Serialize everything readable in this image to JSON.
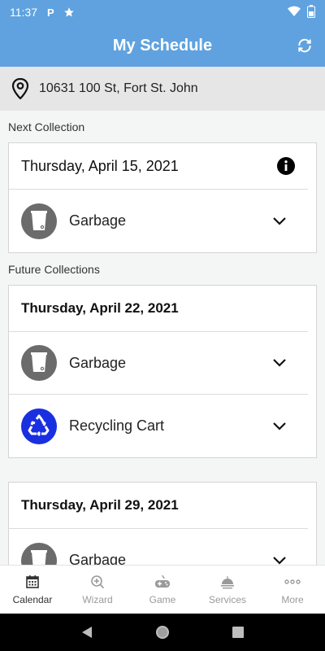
{
  "status_bar": {
    "time": "11:37"
  },
  "app_bar": {
    "title": "My Schedule"
  },
  "address": {
    "text": "10631 100 St, Fort St. John"
  },
  "next_collection": {
    "label": "Next Collection",
    "date": "Thursday, April 15, 2021",
    "items": [
      {
        "label": "Garbage",
        "icon": "garbage-bin-icon"
      }
    ]
  },
  "future_collections": {
    "label": "Future Collections",
    "cards": [
      {
        "date": "Thursday, April 22, 2021",
        "items": [
          {
            "label": "Garbage",
            "icon": "garbage-bin-icon"
          },
          {
            "label": "Recycling Cart",
            "icon": "recycling-icon"
          }
        ]
      },
      {
        "date": "Thursday, April 29, 2021",
        "items": [
          {
            "label": "Garbage",
            "icon": "garbage-bin-icon"
          }
        ]
      }
    ]
  },
  "bottom_nav": [
    {
      "label": "Calendar",
      "icon": "calendar-icon",
      "active": true
    },
    {
      "label": "Wizard",
      "icon": "wizard-icon",
      "active": false
    },
    {
      "label": "Game",
      "icon": "game-icon",
      "active": false
    },
    {
      "label": "Services",
      "icon": "services-icon",
      "active": false
    },
    {
      "label": "More",
      "icon": "more-icon",
      "active": false
    }
  ],
  "colors": {
    "primary": "#5fa2df",
    "garbage": "#6b6b6b",
    "recycling": "#1a2fe0"
  }
}
